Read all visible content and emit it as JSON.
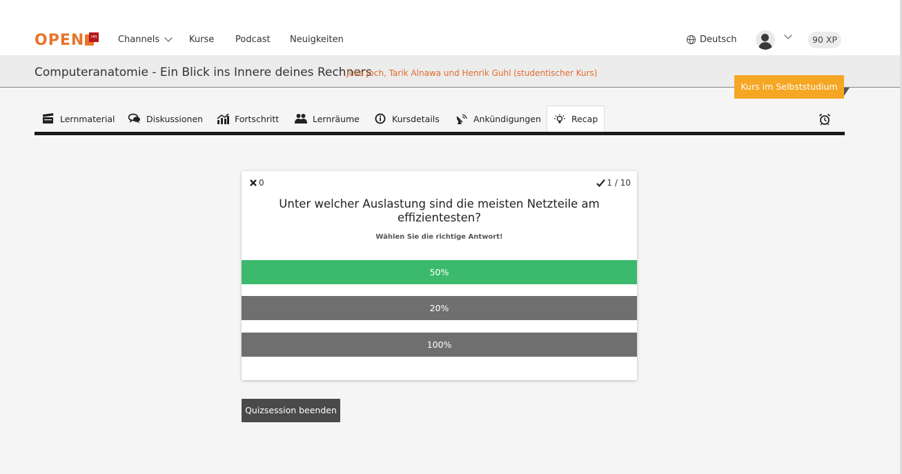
{
  "header": {
    "logo_text": "OPEN",
    "logo_badge": "HPI",
    "nav": {
      "channels": "Channels",
      "kurse": "Kurse",
      "podcast": "Podcast",
      "neuigkeiten": "Neuigkeiten"
    },
    "language": "Deutsch",
    "xp": "90 XP"
  },
  "course": {
    "title": "Computeranatomie - Ein Blick ins Innere deines Rechners",
    "authors": "Julia Joch, Tarik Alnawa und Henrik Guhl (studentischer Kurs)",
    "badge": "Kurs im Selbststudium"
  },
  "tabs": [
    {
      "label": "Lernmaterial",
      "icon": "clapperboard-icon"
    },
    {
      "label": "Diskussionen",
      "icon": "speech-bubbles-icon"
    },
    {
      "label": "Fortschritt",
      "icon": "chart-icon"
    },
    {
      "label": "Lernräume",
      "icon": "group-icon"
    },
    {
      "label": "Kursdetails",
      "icon": "info-icon"
    },
    {
      "label": "Ankündigungen",
      "icon": "satellite-dish-icon"
    },
    {
      "label": "Recap",
      "icon": "lightbulb-icon"
    }
  ],
  "quiz": {
    "wrong_count": "0",
    "progress": "1 / 10",
    "question": "Unter welcher Auslastung sind die meisten Netzteile am effizientesten?",
    "hint": "Wählen Sie die richtige Antwort!",
    "answers": [
      {
        "label": "50%",
        "state": "correct"
      },
      {
        "label": "20%",
        "state": "neutral"
      },
      {
        "label": "100%",
        "state": "neutral"
      }
    ]
  },
  "end_button": "Quizsession beenden",
  "colors": {
    "accent": "#e8742b",
    "badge": "#f5a623",
    "correct": "#3cba6c",
    "neutral": "#6f6f6f"
  }
}
